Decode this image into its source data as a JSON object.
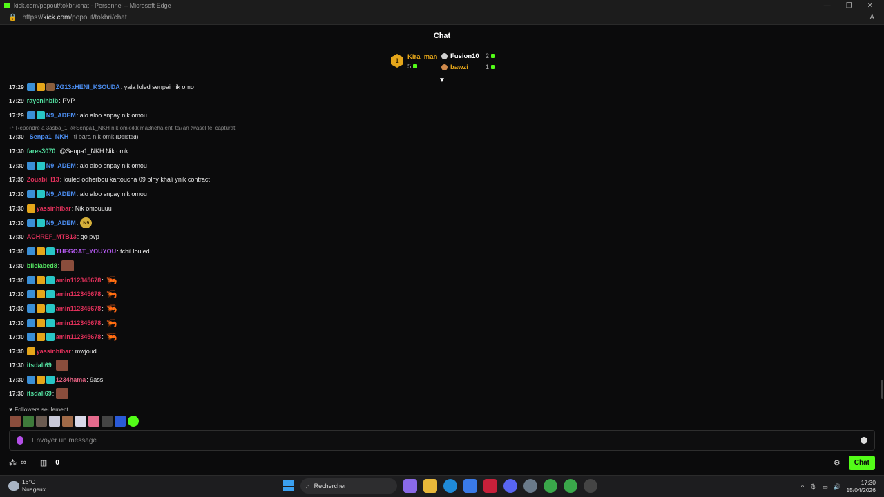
{
  "window": {
    "title": "kick.com/popout/tokbri/chat - Personnel – Microsoft Edge",
    "url_prefix": "https://",
    "url_domain": "kick.com",
    "url_path": "/popout/tokbri/chat",
    "controls": [
      "—",
      "❐",
      "✕"
    ]
  },
  "header": {
    "title": "Chat"
  },
  "leaderboard": {
    "first": {
      "rank": "1",
      "name": "Kira_man",
      "count": "5"
    },
    "second": {
      "name": "Fusion10",
      "count": "2"
    },
    "third": {
      "name": "bawzi",
      "count": "1"
    }
  },
  "messages": [
    {
      "time": "17:29",
      "user": "ZG13xHENI_KSOUDA",
      "color": "#4b8df0",
      "text": ": yala loled senpai nik omo"
    },
    {
      "time": "17:29",
      "user": "rayenlhbib",
      "color": "#53e0a0",
      "text": ": PVP"
    },
    {
      "time": "17:29",
      "user": "N9_ADEM",
      "color": "#4b8df0",
      "text": ": alo aloo snpay nik omou"
    },
    {
      "time": "17:30",
      "user": "Senpa1_NKH",
      "color": "#4b8df0",
      "text": ":"
    },
    {
      "time": "17:30",
      "user": "fares3070",
      "color": "#53e0a0",
      "text": ": @Senpa1_NKH Nik omk"
    },
    {
      "time": "17:30",
      "user": "N9_ADEM",
      "color": "#4b8df0",
      "text": ": alo aloo snpay nik omou"
    },
    {
      "time": "17:30",
      "user": "Zouabi_l13",
      "color": "#e0305a",
      "text": ": louled odherbou kartoucha 09 blhy khali ynik contract"
    },
    {
      "time": "17:30",
      "user": "N9_ADEM",
      "color": "#4b8df0",
      "text": ": alo aloo snpay nik omou"
    },
    {
      "time": "17:30",
      "user": "yassinhibar",
      "color": "#e0305a",
      "text": ": Nik omouuuu"
    },
    {
      "time": "17:30",
      "user": "N9_ADEM",
      "color": "#4b8df0",
      "text": ":"
    },
    {
      "time": "17:30",
      "user": "ACHREF_MTB13",
      "color": "#e0305a",
      "text": ": go pvp"
    },
    {
      "time": "17:30",
      "user": "THEGOAT_YOUYOU",
      "color": "#b45af0",
      "text": ": tchil louled"
    },
    {
      "time": "17:30",
      "user": "bilelabed8",
      "color": "#53e060",
      "text": ":"
    },
    {
      "time": "17:30",
      "user": "amin112345678",
      "color": "#e0305a",
      "text": ":"
    },
    {
      "time": "17:30",
      "user": "amin112345678",
      "color": "#e0305a",
      "text": ":"
    },
    {
      "time": "17:30",
      "user": "amin112345678",
      "color": "#e0305a",
      "text": ":"
    },
    {
      "time": "17:30",
      "user": "amin112345678",
      "color": "#e0305a",
      "text": ":"
    },
    {
      "time": "17:30",
      "user": "amin112345678",
      "color": "#e0305a",
      "text": ":"
    },
    {
      "time": "17:30",
      "user": "yassinhibar",
      "color": "#e0305a",
      "text": ": mwjoud"
    },
    {
      "time": "17:30",
      "user": "itsdali69",
      "color": "#53e0a0",
      "text": ":"
    },
    {
      "time": "17:30",
      "user": "1234hama",
      "color": "#e06080",
      "text": ": 9ass"
    },
    {
      "time": "17:30",
      "user": "itsdali69",
      "color": "#53e0a0",
      "text": ":"
    }
  ],
  "reply": {
    "text": "Répondre à 3asba_1: @Senpa1_NKH nik omkkkk ma3neha enti ta7an twasel fel capturat"
  },
  "deleted": {
    "text": "ti bara nik omk",
    "tag": "(Deleted)"
  },
  "n9_emote": "N9",
  "followers_label": "Followers seulement",
  "input": {
    "placeholder": "Envoyer un message"
  },
  "bottom": {
    "points": "0",
    "chat_button": "Chat"
  },
  "taskbar": {
    "temp": "16°C",
    "weather": "Nuageux",
    "search": "Rechercher",
    "time": "17:30",
    "date": "15/04/2026"
  }
}
